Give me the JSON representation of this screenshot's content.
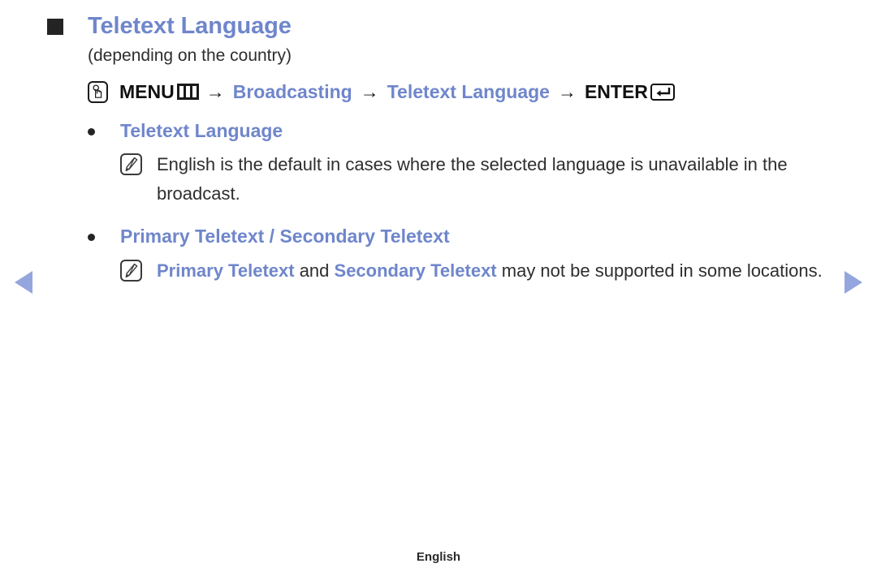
{
  "page": {
    "language_footer": "English",
    "accent_blue": "#6f86cb",
    "arrow_blue": "#94a6dd",
    "text_dark": "#2e2e2e"
  },
  "heading": {
    "marker_icon": "square-bullet-icon",
    "title": "Teletext Language",
    "subtitle": "(depending on the country)"
  },
  "menu_path": {
    "touch_icon": "hand-press-icon",
    "menu_label": "MENU",
    "menu_icon": "menu-bars-icon",
    "arrow1": "→",
    "broadcasting": "Broadcasting",
    "arrow2": "→",
    "teletext_language": "Teletext Language",
    "arrow3": "→",
    "enter_label": "ENTER",
    "enter_icon": "enter-return-icon"
  },
  "sections": [
    {
      "bullet_label": "Teletext Language",
      "note_icon": "note-pencil-icon",
      "note_parts": [
        {
          "text": "English is the default in cases where the selected language is unavailable in the broadcast.",
          "style": "plain"
        }
      ]
    },
    {
      "bullet_label": "Primary Teletext / Secondary Teletext",
      "note_icon": "note-pencil-icon",
      "note_parts": [
        {
          "text": "Primary Teletext",
          "style": "blue"
        },
        {
          "text": " and ",
          "style": "plain"
        },
        {
          "text": "Secondary Teletext",
          "style": "blue"
        },
        {
          "text": " may not be supported in some locations.",
          "style": "plain"
        }
      ]
    }
  ],
  "navigation": {
    "prev_icon": "triangle-left-icon",
    "prev_label": "Previous page",
    "next_icon": "triangle-right-icon",
    "next_label": "Next page"
  }
}
